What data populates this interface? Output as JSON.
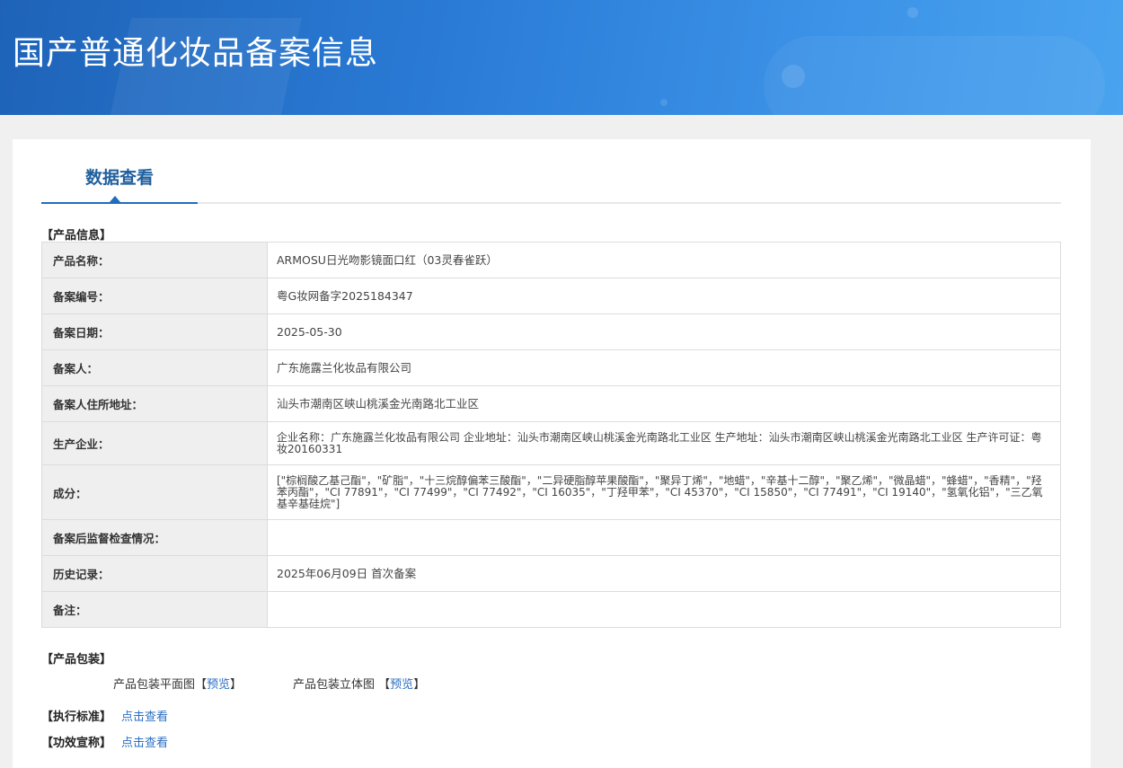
{
  "header": {
    "title": "国产普通化妆品备案信息"
  },
  "tab": {
    "label": "数据查看"
  },
  "product_info": {
    "section_label": "【产品信息】",
    "rows": [
      {
        "key": "产品名称：",
        "value": "ARMOSU日光吻影镜面口红（03灵春雀跃）"
      },
      {
        "key": "备案编号：",
        "value": "粤G妆网备字2025184347"
      },
      {
        "key": "备案日期：",
        "value": "2025-05-30"
      },
      {
        "key": "备案人：",
        "value": "广东施露兰化妆品有限公司"
      },
      {
        "key": "备案人住所地址：",
        "value": "汕头市潮南区峡山桃溪金光南路北工业区"
      },
      {
        "key": "生产企业：",
        "value": "企业名称：广东施露兰化妆品有限公司 企业地址：汕头市潮南区峡山桃溪金光南路北工业区 生产地址：汕头市潮南区峡山桃溪金光南路北工业区 生产许可证：粤妆20160331"
      },
      {
        "key": "成分：",
        "value": "[\"棕榈酸乙基己酯\"，\"矿脂\"，\"十三烷醇偏苯三酸酯\"，\"二异硬脂醇苹果酸酯\"，\"聚异丁烯\"，\"地蜡\"，\"辛基十二醇\"，\"聚乙烯\"，\"微晶蜡\"，\"蜂蜡\"，\"香精\"，\"羟苯丙酯\"，\"CI 77891\"，\"CI 77499\"，\"CI 77492\"，\"CI 16035\"，\"丁羟甲苯\"，\"CI 45370\"，\"CI 15850\"，\"CI 77491\"，\"CI 19140\"，\"氢氧化铝\"，\"三乙氧基辛基硅烷\"]"
      },
      {
        "key": "备案后监督检查情况：",
        "value": ""
      },
      {
        "key": "历史记录：",
        "value": "2025年06月09日 首次备案"
      },
      {
        "key": "备注：",
        "value": ""
      }
    ]
  },
  "packaging": {
    "section_label": "【产品包装】",
    "flat_label": "产品包装平面图",
    "flat_open": "【",
    "flat_link": "预览",
    "flat_close": "】",
    "threed_label": "产品包装立体图",
    "threed_open": "【",
    "threed_link": "预览",
    "threed_close": "】"
  },
  "standard": {
    "section_label": "【执行标准】",
    "link": "点击查看"
  },
  "efficacy": {
    "section_label": "【功效宣称】",
    "link": "点击查看"
  }
}
